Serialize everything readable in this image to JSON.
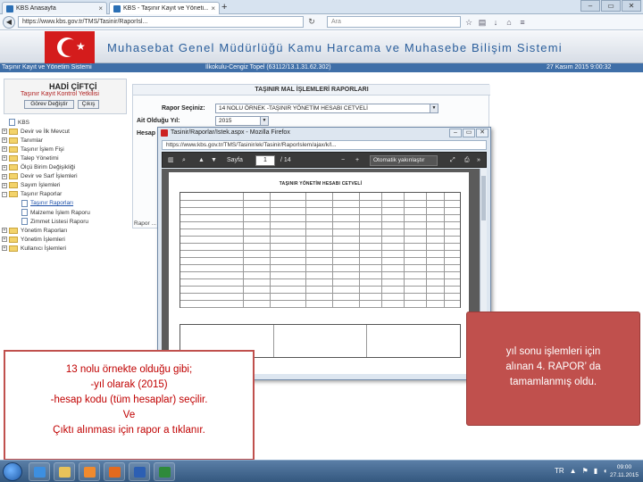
{
  "browser": {
    "tabs": [
      {
        "label": "KBS Anasayfa"
      },
      {
        "label": "KBS - Taşınır Kayıt ve Yöneti..."
      }
    ],
    "new_tab": "+",
    "window_buttons": [
      "‒",
      "▭",
      "✕"
    ],
    "url": "https://www.kbs.gov.tr/TMS/Tasinir/RaporIsl...",
    "search_placeholder": "Ara"
  },
  "site": {
    "title": "Muhasebat Genel Müdürlüğü Kamu Harcama ve Muhasebe Bilişim Sistemi",
    "status_left": "Taşınır Kayıt ve Yönetim Sistemi",
    "status_center": "İlkokulu-Cengiz Topel (63112/13.1.31.62.302)",
    "status_right": "27 Kasım 2015 9:00:32"
  },
  "user": {
    "name": "HADİ ÇİFTÇİ",
    "org": "Taşınır Kayıt Kontrol Yetkilisi",
    "change_role_label": "Görev Değiştir",
    "logout_label": "Çıkış"
  },
  "tree": [
    {
      "label": "KBS",
      "type": "doc",
      "depth": 0,
      "expander": ""
    },
    {
      "label": "Devir ve İlk Mevcut",
      "type": "folder",
      "depth": 0,
      "expander": "+"
    },
    {
      "label": "Tanımlar",
      "type": "folder",
      "depth": 0,
      "expander": "+"
    },
    {
      "label": "Taşınır İşlem Fişi",
      "type": "folder",
      "depth": 0,
      "expander": "+"
    },
    {
      "label": "Talep Yönetimi",
      "type": "folder",
      "depth": 0,
      "expander": "+"
    },
    {
      "label": "Ölçü Birim Değişikliği",
      "type": "folder",
      "depth": 0,
      "expander": "+"
    },
    {
      "label": "Devir ve Sarf İşlemleri",
      "type": "folder",
      "depth": 0,
      "expander": "+"
    },
    {
      "label": "Sayım İşlemleri",
      "type": "folder",
      "depth": 0,
      "expander": "+"
    },
    {
      "label": "Taşınır Raporlar",
      "type": "folder",
      "depth": 0,
      "expander": "-"
    },
    {
      "label": "Taşınır Raporları",
      "type": "doc",
      "depth": 1,
      "expander": "",
      "selected": true
    },
    {
      "label": "Malzeme İşlem Raporu",
      "type": "doc",
      "depth": 1,
      "expander": ""
    },
    {
      "label": "Zimmet Listesi Raporu",
      "type": "doc",
      "depth": 1,
      "expander": ""
    },
    {
      "label": "Yönetim Raporları",
      "type": "folder",
      "depth": 0,
      "expander": "+"
    },
    {
      "label": "Yönetim İşlemleri",
      "type": "folder",
      "depth": 0,
      "expander": "+"
    },
    {
      "label": "Kullanıcı İşlemleri",
      "type": "folder",
      "depth": 0,
      "expander": "+"
    }
  ],
  "form": {
    "panel_title": "TAŞINIR MAL İŞLEMLERİ RAPORLARI",
    "rapor_label": "Rapor Seçiniz:",
    "rapor_value": "14 NOLU ÖRNEK -TAŞINIR YÖNETİM HESABI CETVELİ",
    "yil_label": "Ait Olduğu Yıl:",
    "yil_value": "2015",
    "hesap_label": "Hesap K",
    "footer_label": "Rapor ..."
  },
  "popup": {
    "title": "Tasinir/Raporlar/Istek.aspx - Mozilla Firefox",
    "url": "https://www.kbs.gov.tr/TMS/Tasinir/ek/Tasinir/RaporIslem/ajax/k/l...",
    "window_buttons": [
      "‒",
      "▭",
      "✕"
    ],
    "page_label": "Sayfa",
    "page_current": "1",
    "page_total": "/ 14",
    "zoom_label": "Otomatik yakınlaştır",
    "doc_heading": "TAŞINIR YÖNETİM HESABI CETVELİ"
  },
  "callout_left": {
    "lines": [
      "13 nolu örnekte olduğu gibi;",
      "-yıl olarak (2015)",
      "-hesap kodu (tüm hesaplar) seçilir.",
      "Ve",
      "Çıktı alınması için  rapor a tıklanır."
    ]
  },
  "callout_right": {
    "lines": [
      "yıl sonu işlemleri için",
      "alınan 4. RAPOR’ da",
      "tamamlanmış oldu."
    ]
  },
  "taskbar": {
    "apps": [
      "ie",
      "explorer",
      "media",
      "firefox",
      "word",
      "excel"
    ],
    "tray_lang": "TR",
    "clock_time": "09:00",
    "clock_date": "27.11.2015"
  },
  "colors": {
    "callout_red": "#c0504d",
    "callout_text_red": "#c00000",
    "header_blue": "#2b5f9c",
    "status_blue": "#3f6fa8"
  }
}
